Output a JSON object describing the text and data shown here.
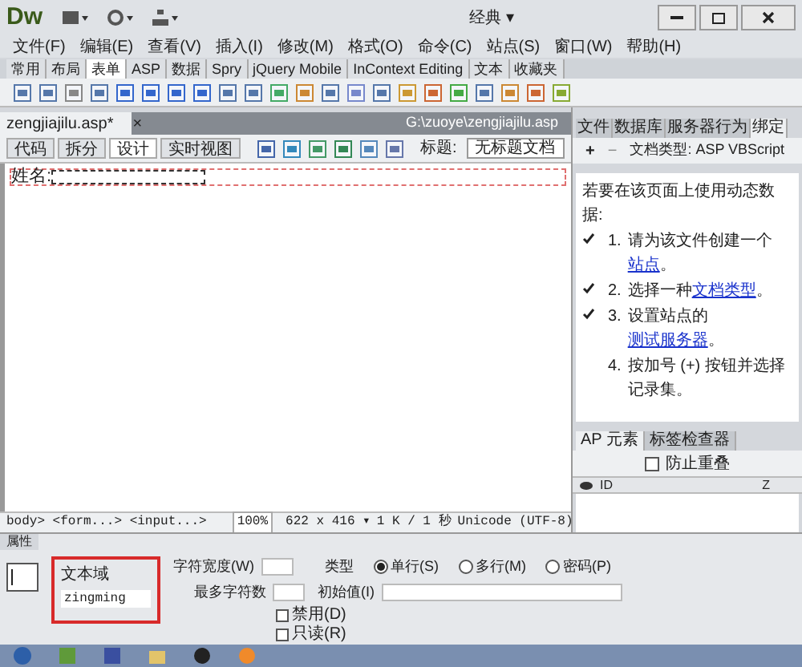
{
  "title_bar": {
    "logo": "Dw",
    "workspace": "经典 ▾"
  },
  "menu": [
    "文件(F)",
    "编辑(E)",
    "查看(V)",
    "插入(I)",
    "修改(M)",
    "格式(O)",
    "命令(C)",
    "站点(S)",
    "窗口(W)",
    "帮助(H)"
  ],
  "insert_tabs": [
    {
      "label": "常用",
      "selected": false
    },
    {
      "label": "布局",
      "selected": false
    },
    {
      "label": "表单",
      "selected": true
    },
    {
      "label": "ASP",
      "selected": false
    },
    {
      "label": "数据",
      "selected": false
    },
    {
      "label": "Spry",
      "selected": false
    },
    {
      "label": "jQuery Mobile",
      "selected": false
    },
    {
      "label": "InContext Editing",
      "selected": false
    },
    {
      "label": "文本",
      "selected": false
    },
    {
      "label": "收藏夹",
      "selected": false
    }
  ],
  "document": {
    "tab": "zengjiajilu.asp*",
    "close": "×",
    "path": "G:\\zuoye\\zengjiajilu.asp",
    "views": [
      {
        "label": "代码",
        "selected": false
      },
      {
        "label": "拆分",
        "selected": false
      },
      {
        "label": "设计",
        "selected": true
      },
      {
        "label": "实时视图",
        "selected": false
      }
    ],
    "title_label": "标题:",
    "title_value": "无标题文档",
    "form_label": "姓名:",
    "status": {
      "tags": "body> <form...> <input...>",
      "zoom": "100%",
      "size": "622 x 416 ▾",
      "speed": "1 K / 1 秒",
      "encoding": "Unicode (UTF-8)"
    }
  },
  "properties": {
    "tab": "属性",
    "field_kind": "文本域",
    "field_name": "zingming",
    "char_width_label": "字符宽度(W)",
    "max_chars_label": "最多字符数",
    "type_label": "类型",
    "types": [
      {
        "label": "单行(S)",
        "selected": true
      },
      {
        "label": "多行(M)",
        "selected": false
      },
      {
        "label": "密码(P)",
        "selected": false
      }
    ],
    "initial_label": "初始值(I)",
    "options": [
      {
        "label": "禁用(D)",
        "checked": false
      },
      {
        "label": "只读(R)",
        "checked": false
      }
    ]
  },
  "right_panel": {
    "tabs": [
      {
        "label": "文件",
        "selected": false
      },
      {
        "label": "数据库",
        "selected": false
      },
      {
        "label": "服务器行为",
        "selected": false
      },
      {
        "label": "绑定",
        "selected": true
      }
    ],
    "add": "+",
    "remove": "−",
    "doc_type": "文档类型: ASP VBScript",
    "intro": "若要在该页面上使用动态数据:",
    "steps": [
      {
        "checked": true,
        "number": "1.",
        "text": "请为该文件创建一个",
        "link": "站点",
        "after": "。"
      },
      {
        "checked": true,
        "number": "2.",
        "text": "选择一种",
        "link": "文档类型",
        "after": "。"
      },
      {
        "checked": true,
        "number": "3.",
        "text": "设置站点的",
        "link": "测试服务器",
        "after": "。"
      },
      {
        "checked": false,
        "number": "4.",
        "text": "按加号 (+) 按钮并选择记录集。"
      }
    ]
  },
  "ap_panel": {
    "tabs": [
      {
        "label": "AP 元素",
        "selected": true
      },
      {
        "label": "标签检查器",
        "selected": false
      }
    ],
    "prevent_overlap": {
      "label": "防止重叠",
      "checked": false
    },
    "columns": [
      "ID",
      "Z"
    ]
  }
}
